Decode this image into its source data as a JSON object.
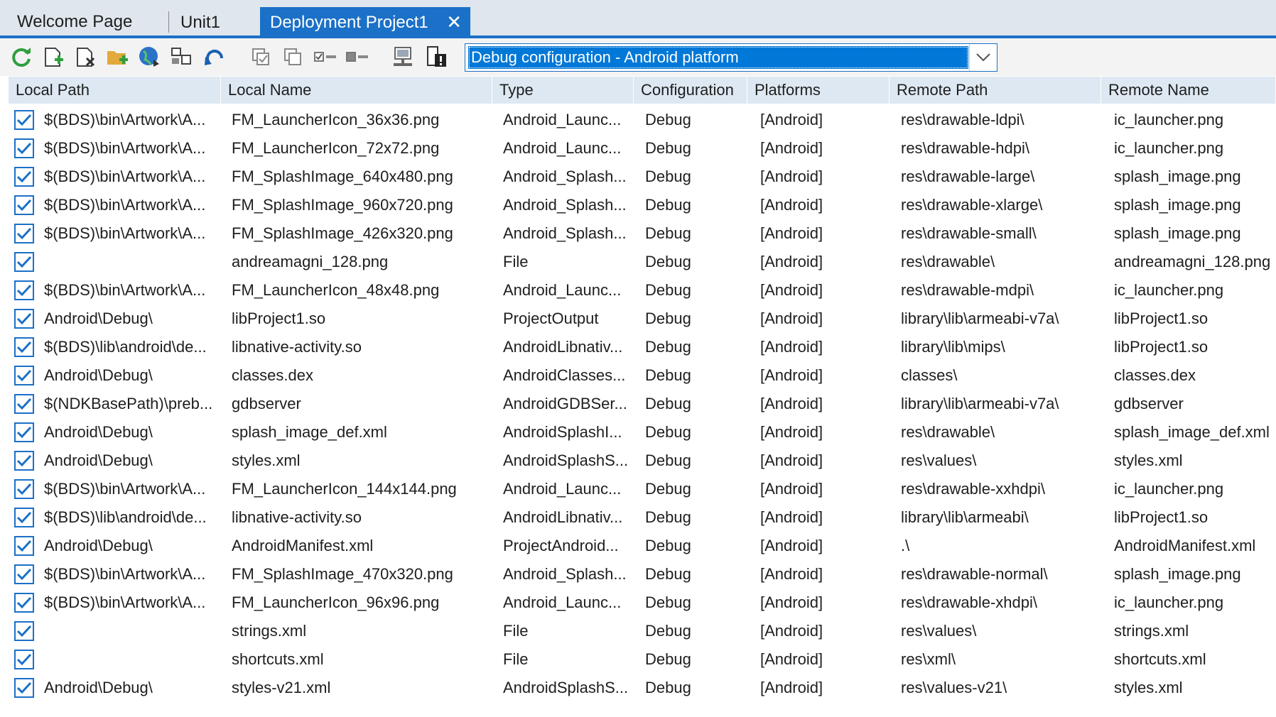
{
  "tabs": [
    {
      "label": "Welcome Page",
      "active": false
    },
    {
      "label": "Unit1",
      "active": false
    },
    {
      "label": "Deployment Project1",
      "active": true
    }
  ],
  "toolbar": {
    "icons": [
      "refresh-icon",
      "add-file-icon",
      "remove-file-icon",
      "add-folder-icon",
      "globe-deploy-icon",
      "layout-icon",
      "undo-icon",
      "copy-checked-icon",
      "copy-all-icon",
      "select-checked-icon",
      "select-unchecked-icon",
      "connect-remote-icon",
      "device-warning-icon"
    ],
    "configuration_value": "Debug configuration - Android platform"
  },
  "columns": [
    "Local Path",
    "Local Name",
    "Type",
    "Configuration",
    "Platforms",
    "Remote Path",
    "Remote Name"
  ],
  "rows": [
    {
      "checked": true,
      "local_path": "$(BDS)\\bin\\Artwork\\A...",
      "local_name": "FM_LauncherIcon_36x36.png",
      "type": "Android_Launc...",
      "configuration": "Debug",
      "platforms": "[Android]",
      "remote_path": "res\\drawable-ldpi\\",
      "remote_name": "ic_launcher.png"
    },
    {
      "checked": true,
      "local_path": "$(BDS)\\bin\\Artwork\\A...",
      "local_name": "FM_LauncherIcon_72x72.png",
      "type": "Android_Launc...",
      "configuration": "Debug",
      "platforms": "[Android]",
      "remote_path": "res\\drawable-hdpi\\",
      "remote_name": "ic_launcher.png"
    },
    {
      "checked": true,
      "local_path": "$(BDS)\\bin\\Artwork\\A...",
      "local_name": "FM_SplashImage_640x480.png",
      "type": "Android_Splash...",
      "configuration": "Debug",
      "platforms": "[Android]",
      "remote_path": "res\\drawable-large\\",
      "remote_name": "splash_image.png"
    },
    {
      "checked": true,
      "local_path": "$(BDS)\\bin\\Artwork\\A...",
      "local_name": "FM_SplashImage_960x720.png",
      "type": "Android_Splash...",
      "configuration": "Debug",
      "platforms": "[Android]",
      "remote_path": "res\\drawable-xlarge\\",
      "remote_name": "splash_image.png"
    },
    {
      "checked": true,
      "local_path": "$(BDS)\\bin\\Artwork\\A...",
      "local_name": "FM_SplashImage_426x320.png",
      "type": "Android_Splash...",
      "configuration": "Debug",
      "platforms": "[Android]",
      "remote_path": "res\\drawable-small\\",
      "remote_name": "splash_image.png"
    },
    {
      "checked": true,
      "local_path": "",
      "local_name": "andreamagni_128.png",
      "type": "File",
      "configuration": "Debug",
      "platforms": "[Android]",
      "remote_path": "res\\drawable\\",
      "remote_name": "andreamagni_128.png"
    },
    {
      "checked": true,
      "local_path": "$(BDS)\\bin\\Artwork\\A...",
      "local_name": "FM_LauncherIcon_48x48.png",
      "type": "Android_Launc...",
      "configuration": "Debug",
      "platforms": "[Android]",
      "remote_path": "res\\drawable-mdpi\\",
      "remote_name": "ic_launcher.png"
    },
    {
      "checked": true,
      "local_path": "Android\\Debug\\",
      "local_name": "libProject1.so",
      "type": "ProjectOutput",
      "configuration": "Debug",
      "platforms": "[Android]",
      "remote_path": "library\\lib\\armeabi-v7a\\",
      "remote_name": "libProject1.so"
    },
    {
      "checked": true,
      "local_path": "$(BDS)\\lib\\android\\de...",
      "local_name": "libnative-activity.so",
      "type": "AndroidLibnativ...",
      "configuration": "Debug",
      "platforms": "[Android]",
      "remote_path": "library\\lib\\mips\\",
      "remote_name": "libProject1.so"
    },
    {
      "checked": true,
      "local_path": "Android\\Debug\\",
      "local_name": "classes.dex",
      "type": "AndroidClasses...",
      "configuration": "Debug",
      "platforms": "[Android]",
      "remote_path": "classes\\",
      "remote_name": "classes.dex"
    },
    {
      "checked": true,
      "local_path": "$(NDKBasePath)\\preb...",
      "local_name": "gdbserver",
      "type": "AndroidGDBSer...",
      "configuration": "Debug",
      "platforms": "[Android]",
      "remote_path": "library\\lib\\armeabi-v7a\\",
      "remote_name": "gdbserver"
    },
    {
      "checked": true,
      "local_path": "Android\\Debug\\",
      "local_name": "splash_image_def.xml",
      "type": "AndroidSplashI...",
      "configuration": "Debug",
      "platforms": "[Android]",
      "remote_path": "res\\drawable\\",
      "remote_name": "splash_image_def.xml"
    },
    {
      "checked": true,
      "local_path": "Android\\Debug\\",
      "local_name": "styles.xml",
      "type": "AndroidSplashS...",
      "configuration": "Debug",
      "platforms": "[Android]",
      "remote_path": "res\\values\\",
      "remote_name": "styles.xml"
    },
    {
      "checked": true,
      "local_path": "$(BDS)\\bin\\Artwork\\A...",
      "local_name": "FM_LauncherIcon_144x144.png",
      "type": "Android_Launc...",
      "configuration": "Debug",
      "platforms": "[Android]",
      "remote_path": "res\\drawable-xxhdpi\\",
      "remote_name": "ic_launcher.png"
    },
    {
      "checked": true,
      "local_path": "$(BDS)\\lib\\android\\de...",
      "local_name": "libnative-activity.so",
      "type": "AndroidLibnativ...",
      "configuration": "Debug",
      "platforms": "[Android]",
      "remote_path": "library\\lib\\armeabi\\",
      "remote_name": "libProject1.so"
    },
    {
      "checked": true,
      "local_path": "Android\\Debug\\",
      "local_name": "AndroidManifest.xml",
      "type": "ProjectAndroid...",
      "configuration": "Debug",
      "platforms": "[Android]",
      "remote_path": ".\\",
      "remote_name": "AndroidManifest.xml"
    },
    {
      "checked": true,
      "local_path": "$(BDS)\\bin\\Artwork\\A...",
      "local_name": "FM_SplashImage_470x320.png",
      "type": "Android_Splash...",
      "configuration": "Debug",
      "platforms": "[Android]",
      "remote_path": "res\\drawable-normal\\",
      "remote_name": "splash_image.png"
    },
    {
      "checked": true,
      "local_path": "$(BDS)\\bin\\Artwork\\A...",
      "local_name": "FM_LauncherIcon_96x96.png",
      "type": "Android_Launc...",
      "configuration": "Debug",
      "platforms": "[Android]",
      "remote_path": "res\\drawable-xhdpi\\",
      "remote_name": "ic_launcher.png"
    },
    {
      "checked": true,
      "local_path": "",
      "local_name": "strings.xml",
      "type": "File",
      "configuration": "Debug",
      "platforms": "[Android]",
      "remote_path": "res\\values\\",
      "remote_name": "strings.xml"
    },
    {
      "checked": true,
      "local_path": "",
      "local_name": "shortcuts.xml",
      "type": "File",
      "configuration": "Debug",
      "platforms": "[Android]",
      "remote_path": "res\\xml\\",
      "remote_name": "shortcuts.xml"
    },
    {
      "checked": true,
      "local_path": "Android\\Debug\\",
      "local_name": "styles-v21.xml",
      "type": "AndroidSplashS...",
      "configuration": "Debug",
      "platforms": "[Android]",
      "remote_path": "res\\values-v21\\",
      "remote_name": "styles.xml"
    }
  ],
  "colors": {
    "accent": "#1b70c7",
    "header_bg": "#dde8f2",
    "selection": "#0078d7"
  }
}
